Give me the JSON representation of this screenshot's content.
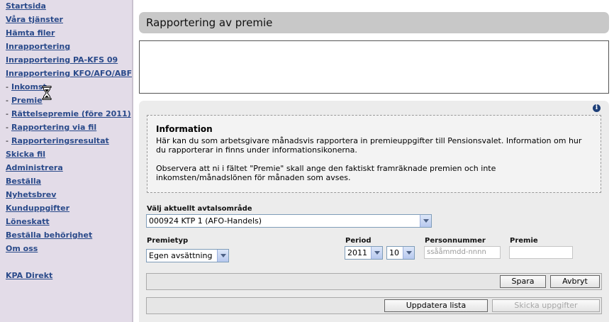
{
  "sidebar": {
    "items": [
      {
        "label": "Startsida",
        "sub": false
      },
      {
        "label": "Våra tjänster",
        "sub": false
      },
      {
        "label": "Hämta filer",
        "sub": false
      },
      {
        "label": "Inrapportering",
        "sub": false
      },
      {
        "label": "Inrapportering PA-KFS 09",
        "sub": false
      },
      {
        "label": "Inrapportering KFO/AFO/ABF",
        "sub": false
      },
      {
        "label": "Inkomst",
        "sub": true
      },
      {
        "label": "Premie",
        "sub": true
      },
      {
        "label": "Rättelsepremie (före 2011)",
        "sub": true
      },
      {
        "label": "Rapportering via fil",
        "sub": true
      },
      {
        "label": "Rapporteringsresultat",
        "sub": true
      },
      {
        "label": "Skicka fil",
        "sub": false
      },
      {
        "label": "Administrera",
        "sub": false
      },
      {
        "label": "Beställa",
        "sub": false
      },
      {
        "label": "Nyhetsbrev",
        "sub": false
      },
      {
        "label": "Kunduppgifter",
        "sub": false
      },
      {
        "label": "Löneskatt",
        "sub": false
      },
      {
        "label": "Beställa behörighet",
        "sub": false
      },
      {
        "label": "Om oss",
        "sub": false
      }
    ],
    "extra_link": "KPA Direkt",
    "dash": "-"
  },
  "page": {
    "title": "Rapportering av premie"
  },
  "info": {
    "icon": "info-icon",
    "icon_glyph": "i",
    "heading": "Information",
    "text1": "Här kan du som arbetsgivare månadsvis rapportera in premieuppgifter till Pensionsvalet. Information om hur du rapporterar in finns under informationsikonerna.",
    "text2": "Observera att ni i fältet \"Premie\" skall ange den faktiskt framräknade premien och inte inkomsten/månadslönen för månaden som avses."
  },
  "form": {
    "agreement_label": "Välj aktuellt avtalsområde",
    "agreement_value": "000924 KTP 1 (AFO-Handels)",
    "premietyp_label": "Premietyp",
    "premietyp_value": "Egen avsättning",
    "period_label": "Period",
    "period_year": "2011",
    "period_month": "10",
    "personnummer_label": "Personnummer",
    "personnummer_placeholder": "ssååmmdd-nnnn",
    "premie_label": "Premie",
    "premie_value": ""
  },
  "buttons": {
    "save": "Spara",
    "cancel": "Avbryt",
    "update_list": "Uppdatera lista",
    "send": "Skicka uppgifter"
  }
}
